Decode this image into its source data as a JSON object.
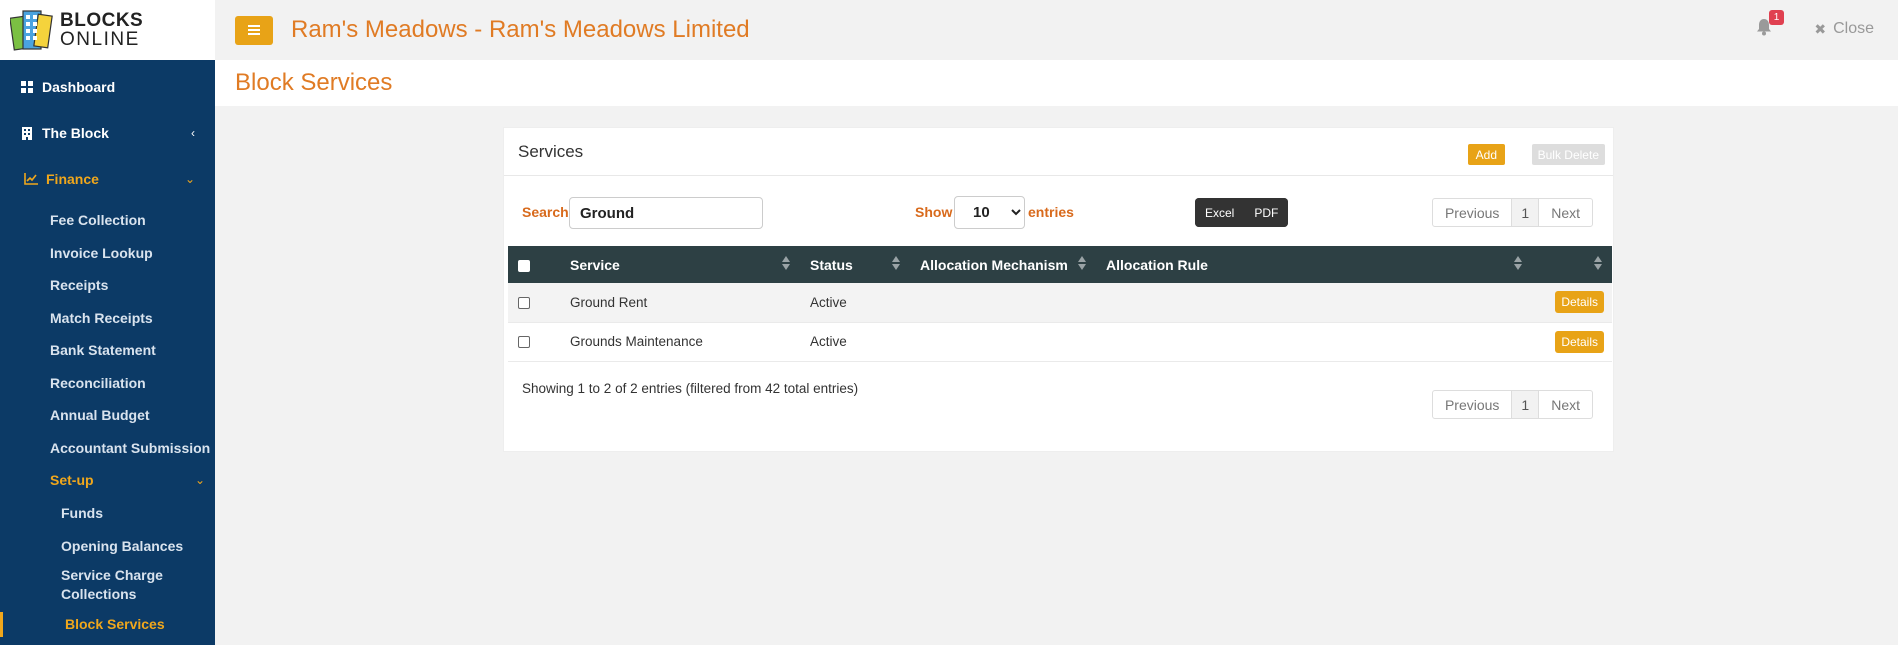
{
  "brand": {
    "line1": "BLOCKS",
    "line2": "ONLINE"
  },
  "header": {
    "title": "Ram's Meadows - Ram's Meadows Limited",
    "notification_count": "1",
    "close_label": "Close"
  },
  "sidebar": {
    "dashboard": "Dashboard",
    "the_block": "The Block",
    "finance": "Finance",
    "finance_items": [
      "Fee Collection",
      "Invoice Lookup",
      "Receipts",
      "Match Receipts",
      "Bank Statement",
      "Reconciliation",
      "Annual Budget",
      "Accountant Submission"
    ],
    "setup": "Set-up",
    "setup_items": [
      "Funds",
      "Opening Balances",
      "Service Charge Collections",
      "Block Services"
    ]
  },
  "page": {
    "title": "Block Services"
  },
  "card": {
    "title": "Services",
    "add_label": "Add",
    "bulk_delete_label": "Bulk Delete",
    "search_label": "Search",
    "search_value": "Ground",
    "show_label": "Show",
    "show_value": "10",
    "entries_label": "entries",
    "export": [
      "Excel",
      "PDF"
    ],
    "pager": {
      "previous": "Previous",
      "page": "1",
      "next": "Next"
    },
    "columns": [
      "Service",
      "Status",
      "Allocation Mechanism",
      "Allocation Rule"
    ],
    "rows": [
      {
        "service": "Ground Rent",
        "status": "Active",
        "action": "Details"
      },
      {
        "service": "Grounds Maintenance",
        "status": "Active",
        "action": "Details"
      }
    ],
    "info": "Showing 1 to 2 of 2 entries (filtered from 42 total entries)"
  }
}
